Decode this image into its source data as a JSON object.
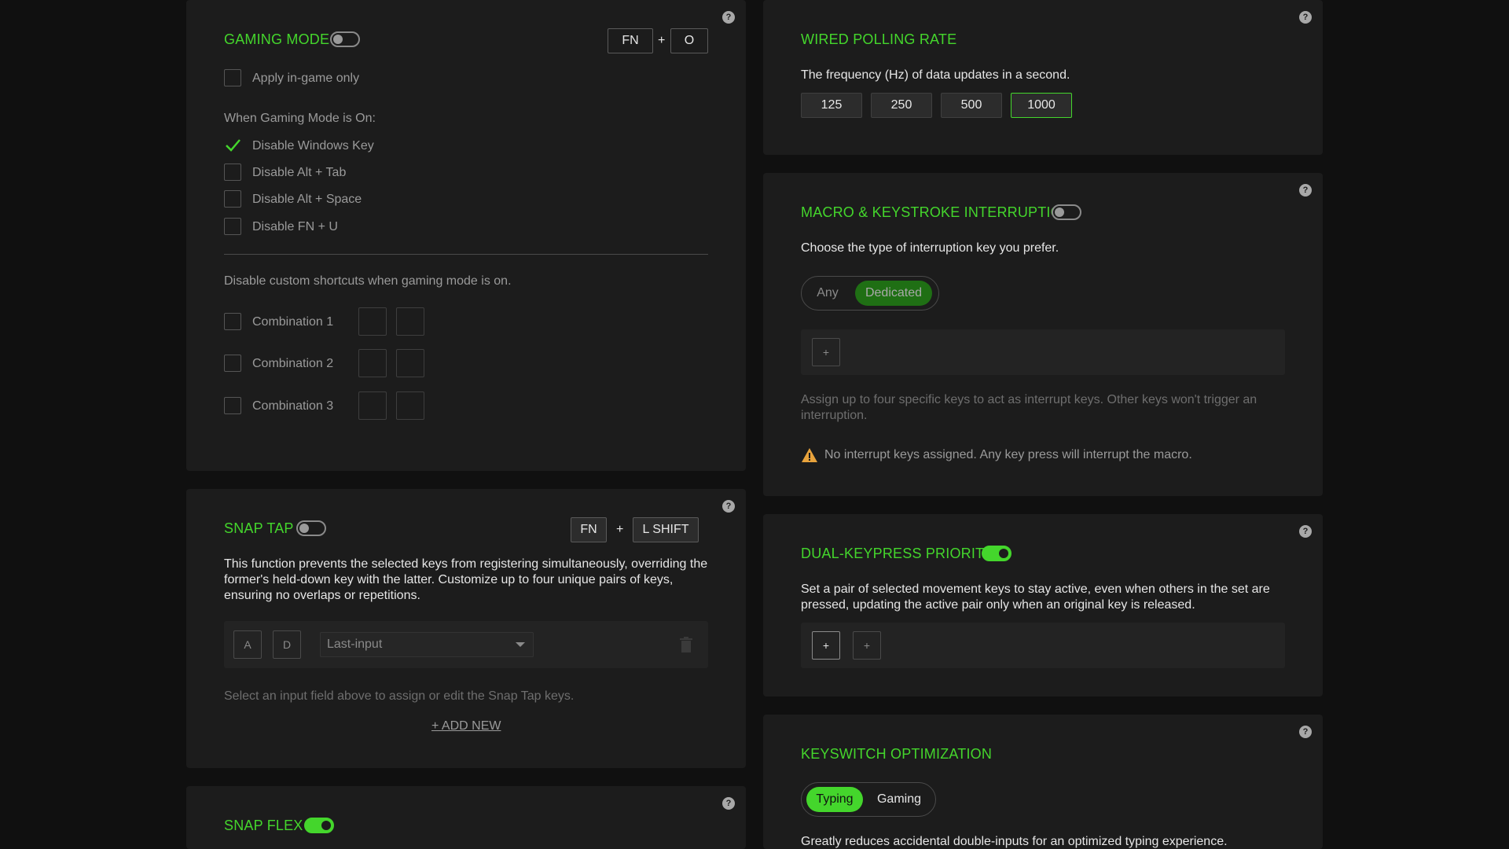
{
  "gaming_mode": {
    "title": "GAMING MODE",
    "toggle_on": false,
    "shortcut": [
      "FN",
      "+",
      "O"
    ],
    "apply_in_game_only": "Apply in-game only",
    "when_on_label": "When Gaming Mode is On:",
    "options": [
      {
        "label": "Disable Windows Key",
        "checked": true
      },
      {
        "label": "Disable Alt + Tab",
        "checked": false
      },
      {
        "label": "Disable Alt + Space",
        "checked": false
      },
      {
        "label": "Disable FN + U",
        "checked": false
      }
    ],
    "custom_shortcuts_label": "Disable custom shortcuts when gaming mode is on.",
    "combinations": [
      "Combination 1",
      "Combination 2",
      "Combination 3"
    ]
  },
  "snap_tap": {
    "title": "SNAP TAP",
    "toggle_on": false,
    "shortcut": [
      "FN",
      "+",
      "L SHIFT"
    ],
    "description": "This function prevents the selected keys from registering simultaneously, overriding the former's held-down key with the latter. Customize up to four unique pairs of keys, ensuring no overlaps or repetitions.",
    "pair_keys": [
      "A",
      "D"
    ],
    "mode_value": "Last-input",
    "hint": "Select an input field above to assign or edit the Snap Tap keys.",
    "add_new": "+ ADD NEW"
  },
  "snap_flex": {
    "title": "SNAP FLEX",
    "toggle_on": true
  },
  "polling_rate": {
    "title": "WIRED POLLING RATE",
    "description": "The frequency (Hz) of data updates in a second.",
    "rates": [
      "125",
      "250",
      "500",
      "1000"
    ],
    "selected": "1000"
  },
  "macro_interrupt": {
    "title": "MACRO & KEYSTROKE INTERRUPTION",
    "toggle_on": false,
    "description": "Choose the type of interruption key you prefer.",
    "options": [
      "Any",
      "Dedicated"
    ],
    "selected": "Dedicated",
    "add_key": "+",
    "assign_text": "Assign up to four specific keys to act as interrupt keys. Other keys won't trigger an interruption.",
    "warning": "No interrupt keys assigned. Any key press will interrupt the macro."
  },
  "dual_keypress": {
    "title": "DUAL-KEYPRESS PRIORITY",
    "toggle_on": true,
    "description": "Set a pair of selected movement keys to stay active, even when others in the set are pressed, updating the active pair only when an original key is released.",
    "add_keys": [
      "+",
      "+"
    ]
  },
  "keyswitch": {
    "title": "KEYSWITCH OPTIMIZATION",
    "options": [
      "Typing",
      "Gaming"
    ],
    "selected": "Typing",
    "description": "Greatly reduces accidental double-inputs for an optimized typing experience."
  },
  "help_glyph": "?",
  "colors": {
    "accent": "#44d62c",
    "panel_bg": "#1c1c1c",
    "page_bg": "#101010",
    "warning": "#e8a33c"
  }
}
